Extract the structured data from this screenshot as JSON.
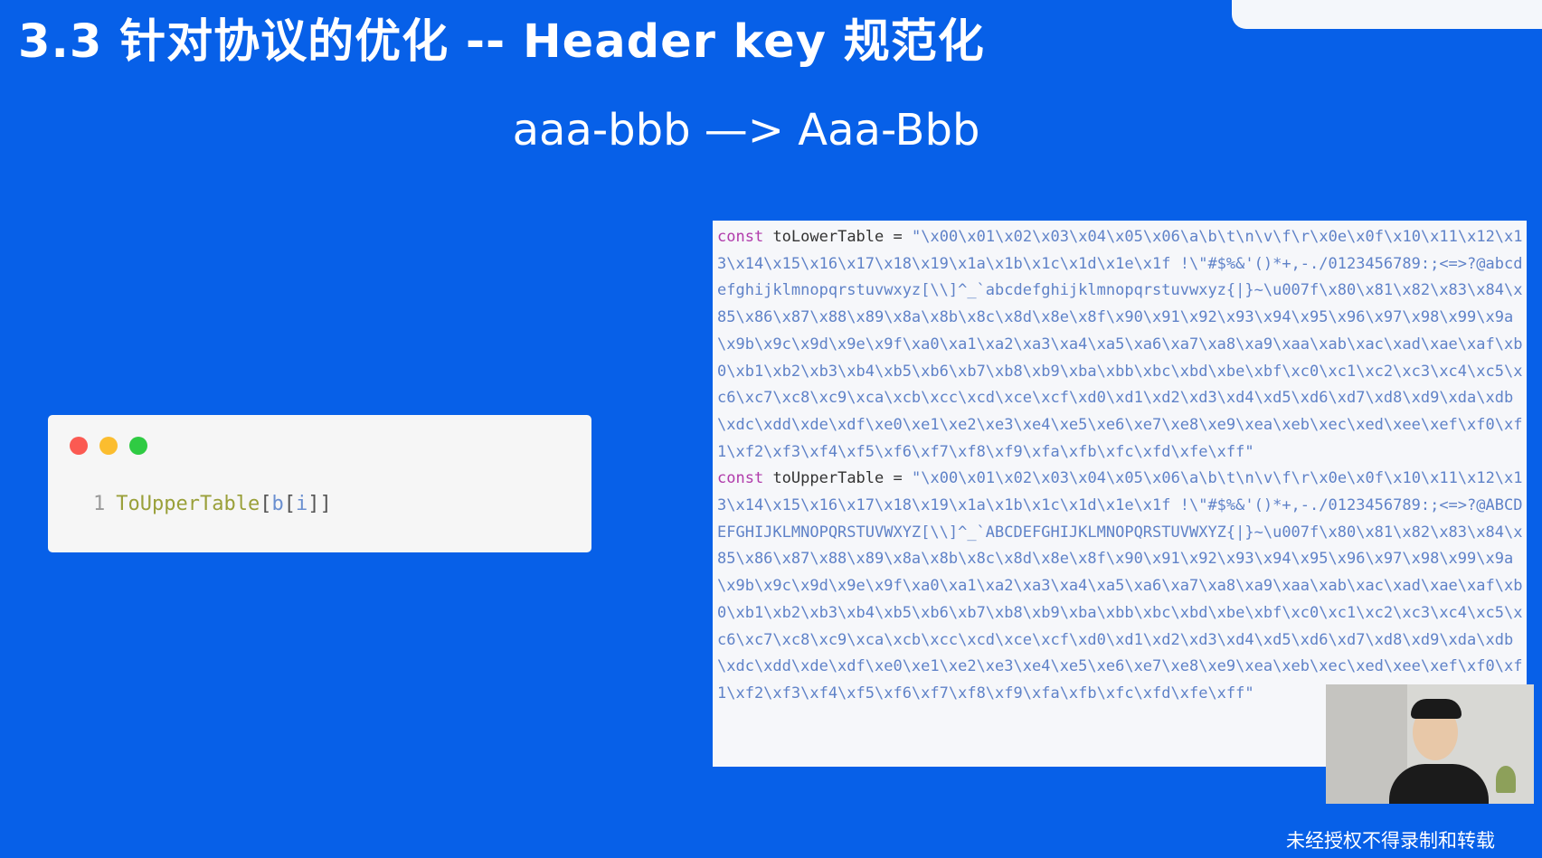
{
  "slide": {
    "title": "3.3 针对协议的优化 -- Header key 规范化",
    "subtitle": "aaa-bbb —> Aaa-Bbb",
    "background_color": "#0760e8"
  },
  "small_code": {
    "line_number": "1",
    "function_name": "ToUpperTable",
    "open_outer": "[",
    "var_b": "b",
    "open_inner": "[",
    "var_i": "i",
    "close_brackets": "]]"
  },
  "lower_table": {
    "keyword": "const",
    "name": "toLowerTable",
    "equals": "=",
    "value": "\"\\x00\\x01\\x02\\x03\\x04\\x05\\x06\\a\\b\\t\\n\\v\\f\\r\\x0e\\x0f\\x10\\x11\\x12\\x13\\x14\\x15\\x16\\x17\\x18\\x19\\x1a\\x1b\\x1c\\x1d\\x1e\\x1f !\\\"#$%&'()*+,-./0123456789:;<=>?@abcdefghijklmnopqrstuvwxyz[\\\\]^_`abcdefghijklmnopqrstuvwxyz{|}~\\u007f\\x80\\x81\\x82\\x83\\x84\\x85\\x86\\x87\\x88\\x89\\x8a\\x8b\\x8c\\x8d\\x8e\\x8f\\x90\\x91\\x92\\x93\\x94\\x95\\x96\\x97\\x98\\x99\\x9a\\x9b\\x9c\\x9d\\x9e\\x9f\\xa0\\xa1\\xa2\\xa3\\xa4\\xa5\\xa6\\xa7\\xa8\\xa9\\xaa\\xab\\xac\\xad\\xae\\xaf\\xb0\\xb1\\xb2\\xb3\\xb4\\xb5\\xb6\\xb7\\xb8\\xb9\\xba\\xbb\\xbc\\xbd\\xbe\\xbf\\xc0\\xc1\\xc2\\xc3\\xc4\\xc5\\xc6\\xc7\\xc8\\xc9\\xca\\xcb\\xcc\\xcd\\xce\\xcf\\xd0\\xd1\\xd2\\xd3\\xd4\\xd5\\xd6\\xd7\\xd8\\xd9\\xda\\xdb\\xdc\\xdd\\xde\\xdf\\xe0\\xe1\\xe2\\xe3\\xe4\\xe5\\xe6\\xe7\\xe8\\xe9\\xea\\xeb\\xec\\xed\\xee\\xef\\xf0\\xf1\\xf2\\xf3\\xf4\\xf5\\xf6\\xf7\\xf8\\xf9\\xfa\\xfb\\xfc\\xfd\\xfe\\xff\""
  },
  "upper_table": {
    "keyword": "const",
    "name": "toUpperTable",
    "equals": "=",
    "value": "\"\\x00\\x01\\x02\\x03\\x04\\x05\\x06\\a\\b\\t\\n\\v\\f\\r\\x0e\\x0f\\x10\\x11\\x12\\x13\\x14\\x15\\x16\\x17\\x18\\x19\\x1a\\x1b\\x1c\\x1d\\x1e\\x1f !\\\"#$%&'()*+,-./0123456789:;<=>?@ABCDEFGHIJKLMNOPQRSTUVWXYZ[\\\\]^_`ABCDEFGHIJKLMNOPQRSTUVWXYZ{|}~\\u007f\\x80\\x81\\x82\\x83\\x84\\x85\\x86\\x87\\x88\\x89\\x8a\\x8b\\x8c\\x8d\\x8e\\x8f\\x90\\x91\\x92\\x93\\x94\\x95\\x96\\x97\\x98\\x99\\x9a\\x9b\\x9c\\x9d\\x9e\\x9f\\xa0\\xa1\\xa2\\xa3\\xa4\\xa5\\xa6\\xa7\\xa8\\xa9\\xaa\\xab\\xac\\xad\\xae\\xaf\\xb0\\xb1\\xb2\\xb3\\xb4\\xb5\\xb6\\xb7\\xb8\\xb9\\xba\\xbb\\xbc\\xbd\\xbe\\xbf\\xc0\\xc1\\xc2\\xc3\\xc4\\xc5\\xc6\\xc7\\xc8\\xc9\\xca\\xcb\\xcc\\xcd\\xce\\xcf\\xd0\\xd1\\xd2\\xd3\\xd4\\xd5\\xd6\\xd7\\xd8\\xd9\\xda\\xdb\\xdc\\xdd\\xde\\xdf\\xe0\\xe1\\xe2\\xe3\\xe4\\xe5\\xe6\\xe7\\xe8\\xe9\\xea\\xeb\\xec\\xed\\xee\\xef\\xf0\\xf1\\xf2\\xf3\\xf4\\xf5\\xf6\\xf7\\xf8\\xf9\\xfa\\xfb\\xfc\\xfd\\xfe\\xff\""
  },
  "footer": {
    "watermark": "未经授权不得录制和转载"
  },
  "colors": {
    "keyword": "#b13cab",
    "string": "#5f82c8",
    "function": "#9aa03a",
    "dot_red": "#fb5a52",
    "dot_yellow": "#fbbd2f",
    "dot_green": "#2fcb43"
  }
}
